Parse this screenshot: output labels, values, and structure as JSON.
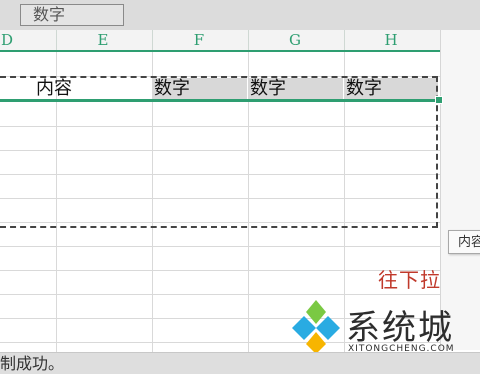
{
  "toolbar": {
    "name_box_value": "数字"
  },
  "columns": [
    "D",
    "E",
    "F",
    "G",
    "H"
  ],
  "row": {
    "cells": [
      "",
      "内容",
      "数字",
      "数字",
      "数字"
    ]
  },
  "tooltip": {
    "text": "内容"
  },
  "annotation": {
    "text": "往下拉",
    "color": "#c0392b"
  },
  "watermark": {
    "text": "系统城",
    "subtext": "XITONGCHENG.COM"
  },
  "status": {
    "text": "制成功。"
  },
  "colors": {
    "accent": "#2e9e71",
    "selection": "#d8d8d8"
  },
  "icons": {
    "watermark_logo": "diamond-logo-icon"
  }
}
